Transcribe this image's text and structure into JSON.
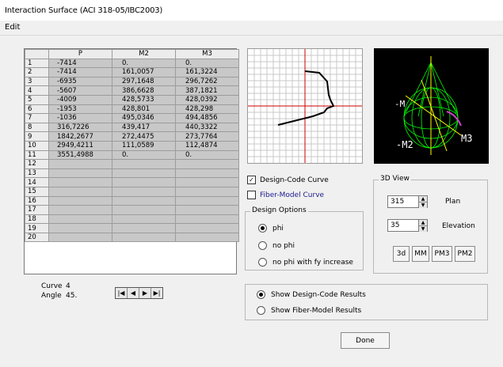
{
  "window": {
    "title": "Interaction Surface  (ACI 318-05/IBC2003)"
  },
  "menu": {
    "edit": "Edit"
  },
  "table": {
    "headers": [
      "P",
      "M2",
      "M3"
    ],
    "rows": [
      {
        "n": "1",
        "p": "-7414",
        "m2": "0.",
        "m3": "0."
      },
      {
        "n": "2",
        "p": "-7414",
        "m2": "161,0057",
        "m3": "161,3224"
      },
      {
        "n": "3",
        "p": "-6935",
        "m2": "297,1648",
        "m3": "296,7262"
      },
      {
        "n": "4",
        "p": "-5607",
        "m2": "386,6628",
        "m3": "387,1821"
      },
      {
        "n": "5",
        "p": "-4009",
        "m2": "428,5733",
        "m3": "428,0392"
      },
      {
        "n": "6",
        "p": "-1953",
        "m2": "428,801",
        "m3": "428,298"
      },
      {
        "n": "7",
        "p": "-1036",
        "m2": "495,0346",
        "m3": "494,4856"
      },
      {
        "n": "8",
        "p": "316,7226",
        "m2": "439,417",
        "m3": "440,3322"
      },
      {
        "n": "9",
        "p": "1842,2677",
        "m2": "272,4475",
        "m3": "273,7764"
      },
      {
        "n": "10",
        "p": "2949,4211",
        "m2": "111,0589",
        "m3": "112,4874"
      },
      {
        "n": "11",
        "p": "3551,4988",
        "m2": "0.",
        "m3": "0."
      },
      {
        "n": "12",
        "p": "",
        "m2": "",
        "m3": ""
      },
      {
        "n": "13",
        "p": "",
        "m2": "",
        "m3": ""
      },
      {
        "n": "14",
        "p": "",
        "m2": "",
        "m3": ""
      },
      {
        "n": "15",
        "p": "",
        "m2": "",
        "m3": ""
      },
      {
        "n": "16",
        "p": "",
        "m2": "",
        "m3": ""
      },
      {
        "n": "17",
        "p": "",
        "m2": "",
        "m3": ""
      },
      {
        "n": "18",
        "p": "",
        "m2": "",
        "m3": ""
      },
      {
        "n": "19",
        "p": "",
        "m2": "",
        "m3": ""
      },
      {
        "n": "20",
        "p": "",
        "m2": "",
        "m3": ""
      }
    ]
  },
  "curve": {
    "curve_label": "Curve",
    "curve_value": "4",
    "angle_label": "Angle",
    "angle_value": "45."
  },
  "nav_icons": [
    "first-icon",
    "prev-icon",
    "next-icon",
    "last-icon"
  ],
  "plot3d": {
    "label_m2": "-M2",
    "label_m3": "M3",
    "label_m": "-M"
  },
  "options": {
    "design_code_curve": {
      "label": "Design-Code Curve",
      "checked": true
    },
    "fiber_model_curve": {
      "label": "Fiber-Model Curve",
      "checked": false
    },
    "design_options": {
      "title": "Design Options",
      "items": [
        {
          "label": "phi",
          "selected": true
        },
        {
          "label": "no phi",
          "selected": false
        },
        {
          "label": "no phi with fy increase",
          "selected": false
        }
      ]
    }
  },
  "view3d": {
    "title": "3D View",
    "plan_value": "315",
    "plan_label": "Plan",
    "elevation_value": "35",
    "elevation_label": "Elevation",
    "buttons": [
      "3d",
      "MM",
      "PM3",
      "PM2"
    ]
  },
  "results": [
    {
      "label": "Show Design-Code Results",
      "selected": true
    },
    {
      "label": "Show Fiber-Model Results",
      "selected": false
    }
  ],
  "done": "Done",
  "colors": {
    "fiber_label": "#1a1a8c",
    "wire_green": "#00ff00",
    "axis_red": "#d00000"
  }
}
